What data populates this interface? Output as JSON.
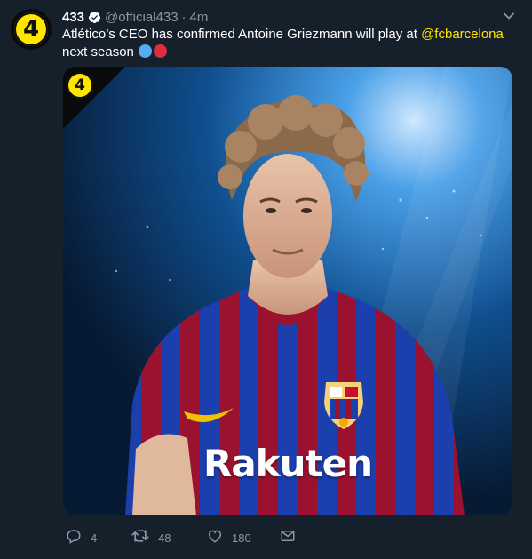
{
  "tweet": {
    "display_name": "433",
    "handle": "@official433",
    "separator": "·",
    "timestamp": "4m",
    "avatar_text": "4",
    "text_prefix": "Atlético’s CEO has confirmed Antoine Griezmann will play at ",
    "mention": "@fcbarcelona",
    "text_suffix": " next season",
    "emoji": [
      "blue-circle",
      "red-circle"
    ]
  },
  "media": {
    "badge_text": "4",
    "sponsor_text": "Rakuten",
    "crest_text": "FCB"
  },
  "actions": {
    "reply_count": "4",
    "retweet_count": "48",
    "like_count": "180"
  },
  "colors": {
    "background": "#15202b",
    "secondary_text": "#8899a6",
    "mention": "#ffe600",
    "brand_yellow": "#ffe600"
  },
  "icons": [
    "verified-icon",
    "chevron-down-icon",
    "reply-icon",
    "retweet-icon",
    "heart-icon",
    "envelope-icon"
  ]
}
